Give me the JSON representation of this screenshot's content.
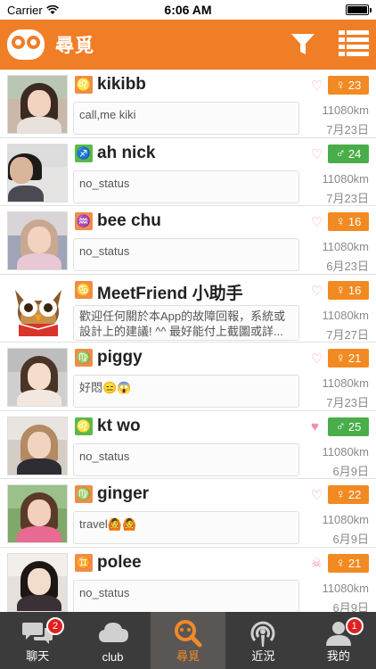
{
  "status_bar": {
    "carrier": "Carrier",
    "time": "6:06 AM"
  },
  "nav": {
    "title": "尋覓"
  },
  "users": [
    {
      "name": "kikibb",
      "zodiac": "♌",
      "status": "call,me kiki",
      "age": "23",
      "gender": "female",
      "gender_symbol": "♀",
      "distance": "11080km",
      "date": "7月23日",
      "heart": "outline"
    },
    {
      "name": "ah nick",
      "zodiac": "♐",
      "status": "no_status",
      "age": "24",
      "gender": "male",
      "gender_symbol": "♂",
      "distance": "11080km",
      "date": "7月23日",
      "heart": "outline"
    },
    {
      "name": "bee chu",
      "zodiac": "♒",
      "status": "no_status",
      "age": "16",
      "gender": "female",
      "gender_symbol": "♀",
      "distance": "11080km",
      "date": "6月23日",
      "heart": "outline"
    },
    {
      "name": "MeetFriend 小助手",
      "zodiac": "♋",
      "status": "歡迎任何關於本App的故障回報，系統或設計上的建議! ^^ 最好能付上截圖或詳...",
      "age": "16",
      "gender": "female",
      "gender_symbol": "♀",
      "distance": "11080km",
      "date": "7月27日",
      "heart": "outline"
    },
    {
      "name": "piggy",
      "zodiac": "♍",
      "status": "好悶😑😱",
      "age": "21",
      "gender": "female",
      "gender_symbol": "♀",
      "distance": "11080km",
      "date": "7月23日",
      "heart": "outline"
    },
    {
      "name": "kt wo",
      "zodiac": "♌",
      "status": "no_status",
      "age": "25",
      "gender": "male",
      "gender_symbol": "♂",
      "distance": "11080km",
      "date": "6月9日",
      "heart": "filled"
    },
    {
      "name": "ginger",
      "zodiac": "♍",
      "status": "travel🙆🙆",
      "age": "22",
      "gender": "female",
      "gender_symbol": "♀",
      "distance": "11080km",
      "date": "6月9日",
      "heart": "outline"
    },
    {
      "name": "polee",
      "zodiac": "♊",
      "status": "no_status",
      "age": "21",
      "gender": "female",
      "gender_symbol": "♀",
      "distance": "11080km",
      "date": "6月9日",
      "heart": "skull"
    }
  ],
  "tabs": [
    {
      "label": "聊天",
      "icon": "chat-icon",
      "badge": "2"
    },
    {
      "label": "club",
      "icon": "cloud-icon",
      "badge": ""
    },
    {
      "label": "尋覓",
      "icon": "search-icon",
      "badge": ""
    },
    {
      "label": "近況",
      "icon": "podcast-icon",
      "badge": ""
    },
    {
      "label": "我的",
      "icon": "profile-icon",
      "badge": "1"
    }
  ],
  "colors": {
    "brand": "#f07e26",
    "female_badge": "#f28a22",
    "male_badge": "#49ad49",
    "tabbar": "#3b3b3b"
  }
}
